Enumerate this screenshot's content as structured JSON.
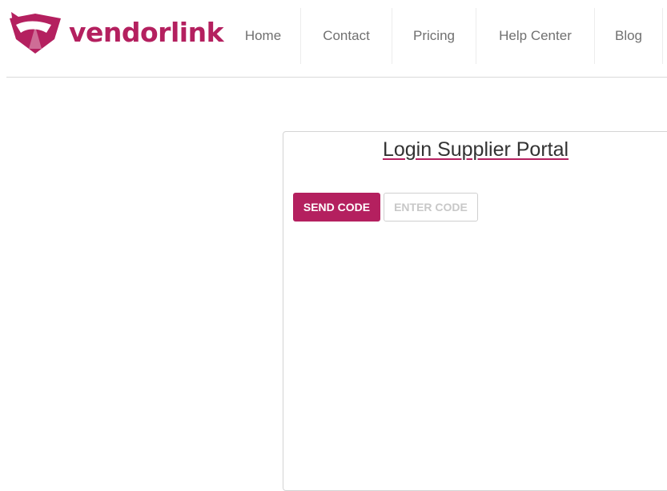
{
  "brand": {
    "name": "vendorlink",
    "color": "#b4205f"
  },
  "nav": {
    "items": [
      {
        "label": "Home"
      },
      {
        "label": "Contact"
      },
      {
        "label": "Pricing"
      },
      {
        "label": "Help Center"
      },
      {
        "label": "Blog"
      }
    ]
  },
  "login": {
    "title": "Login Supplier Portal",
    "send_code_label": "SEND CODE",
    "enter_code_label": "ENTER CODE"
  },
  "icons": {
    "logo": "vendorlink-logo-icon"
  }
}
